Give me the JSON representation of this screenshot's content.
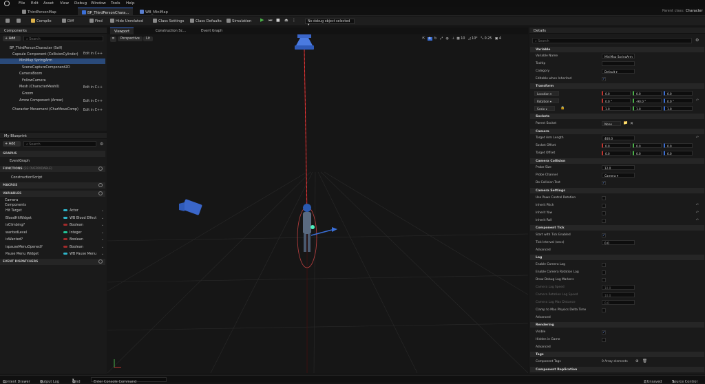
{
  "menu": [
    "File",
    "Edit",
    "Asset",
    "View",
    "Debug",
    "Window",
    "Tools",
    "Help"
  ],
  "tabs": {
    "project": "ThirdPersonMap",
    "blueprint": "BP_ThirdPersonChara...",
    "widget": "WB_MiniMap"
  },
  "parent_class": {
    "label": "Parent class:",
    "value": "Character"
  },
  "toolbar": {
    "compile": "Compile",
    "diff": "Diff",
    "find": "Find",
    "hide_unrelated": "Hide Unrelated",
    "class_settings": "Class Settings",
    "class_defaults": "Class Defaults",
    "simulation": "Simulation",
    "debug_object": "No debug object selected"
  },
  "components": {
    "title": "Components",
    "add": "+ Add",
    "search_placeholder": "Search",
    "edit_in_cpp": "Edit in C++",
    "items": [
      "BP_ThirdPersonCharacter (Self)",
      "Capsule Component (CollisionCylinder)",
      "MiniMap SpringArm",
      "SceneCaptureComponent2D",
      "CameraBoom",
      "FollowCamera",
      "Mesh (CharacterMesh0)",
      "Groom",
      "Arrow Component (Arrow)",
      "Character Movement (CharMoveComp)"
    ]
  },
  "blueprint": {
    "title": "My Blueprint",
    "add": "+ Add",
    "search_placeholder": "Search",
    "graphs": "GRAPHS",
    "event_graph": "EventGraph",
    "functions": "FUNCTIONS",
    "functions_note": "(33 OVERRIDABLE)",
    "construction_script": "ConstructionScript",
    "macros": "MACROS",
    "variables": "VARIABLES",
    "cat_camera": "Camera",
    "cat_components": "Components",
    "vars": [
      {
        "name": "Hit Target",
        "type": "Actor",
        "color": "#2fb5c9"
      },
      {
        "name": "BloodHitWidget",
        "type": "WB Blood Effect",
        "color": "#2fb5c9"
      },
      {
        "name": "isClimbing?",
        "type": "Boolean",
        "color": "#a32b2b"
      },
      {
        "name": "wantedLevel",
        "type": "Integer",
        "color": "#23c498"
      },
      {
        "name": "isWanted?",
        "type": "Boolean",
        "color": "#a32b2b"
      },
      {
        "name": "ispauseMenuOpened?",
        "type": "Boolean",
        "color": "#a32b2b"
      },
      {
        "name": "Pause Menu Widget",
        "type": "WB Pause Menu",
        "color": "#2fb5c9"
      }
    ],
    "event_dispatchers": "EVENT DISPATCHERS"
  },
  "center_tabs": {
    "viewport": "Viewport",
    "construction": "Construction Sc...",
    "event_graph": "Event Graph"
  },
  "viewport": {
    "perspective": "Perspective",
    "lit": "Lit",
    "grid": "10",
    "angle": "10°",
    "scale": "0.25",
    "speed": "4"
  },
  "details": {
    "title": "Details",
    "search_placeholder": "Search",
    "sections": {
      "variable": "Variable",
      "transform": "Transform",
      "sockets": "Sockets",
      "camera": "Camera",
      "camera_collision": "Camera Collision",
      "camera_settings": "Camera Settings",
      "component_tick": "Component Tick",
      "advanced": "Advanced",
      "lag": "Lag",
      "advanced2": "Advanced",
      "rendering": "Rendering",
      "advanced3": "Advanced",
      "tags": "Tags",
      "component_replication": "Component Replication"
    },
    "variable_name_label": "Variable Name",
    "variable_name": "MiniMap SpringArm",
    "tooltip_label": "Tooltip",
    "category_label": "Category",
    "category": "Default",
    "editable_label": "Editable when Inherited",
    "location_label": "Location",
    "rotation_label": "Rotation",
    "scale_label": "Scale",
    "location": [
      "0.0",
      "0.0",
      "0.0"
    ],
    "rotation": [
      "0.0 °",
      "-90.0 °",
      "0.0 °"
    ],
    "scale": [
      "1.0",
      "1.0",
      "1.0"
    ],
    "parent_socket_label": "Parent Socket",
    "parent_socket": "None",
    "target_arm_length_label": "Target Arm Length",
    "target_arm_length": "460.0",
    "socket_offset_label": "Socket Offset",
    "socket_offset": [
      "0.0",
      "0.0",
      "0.0"
    ],
    "target_offset_label": "Target Offset",
    "target_offset": [
      "0.0",
      "0.0",
      "0.0"
    ],
    "probe_size_label": "Probe Size",
    "probe_size": "12.0",
    "probe_channel_label": "Probe Channel",
    "probe_channel": "Camera",
    "do_collision_label": "Do Collision Test",
    "use_pawn_label": "Use Pawn Control Rotation",
    "inherit_pitch_label": "Inherit Pitch",
    "inherit_yaw_label": "Inherit Yaw",
    "inherit_roll_label": "Inherit Roll",
    "start_tick_label": "Start with Tick Enabled",
    "tick_interval_label": "Tick Interval (secs)",
    "tick_interval": "0.0",
    "enable_camera_lag_label": "Enable Camera Lag",
    "enable_camera_rot_lag_label": "Enable Camera Rotation Lag",
    "draw_debug_lag_label": "Draw Debug Lag Markers",
    "camera_lag_speed_label": "Camera Lag Speed",
    "camera_lag_speed": "10.0",
    "camera_rot_lag_speed_label": "Camera Rotation Lag Speed",
    "camera_rot_lag_speed": "10.0",
    "camera_lag_max_label": "Camera Lag Max Distance",
    "camera_lag_max": "0.0",
    "clamp_label": "Clamp to Max Physics Delta Time",
    "visible_label": "Visible",
    "hidden_in_game_label": "Hidden in Game",
    "component_tags_label": "Component Tags",
    "component_tags": "0 Array elements"
  },
  "statusbar": {
    "content_drawer": "Content Drawer",
    "output_log": "Output Log",
    "cmd": "Cmd",
    "console_placeholder": "Enter Console Command",
    "unsaved": "2 Unsaved",
    "source_control": "Source Control"
  }
}
